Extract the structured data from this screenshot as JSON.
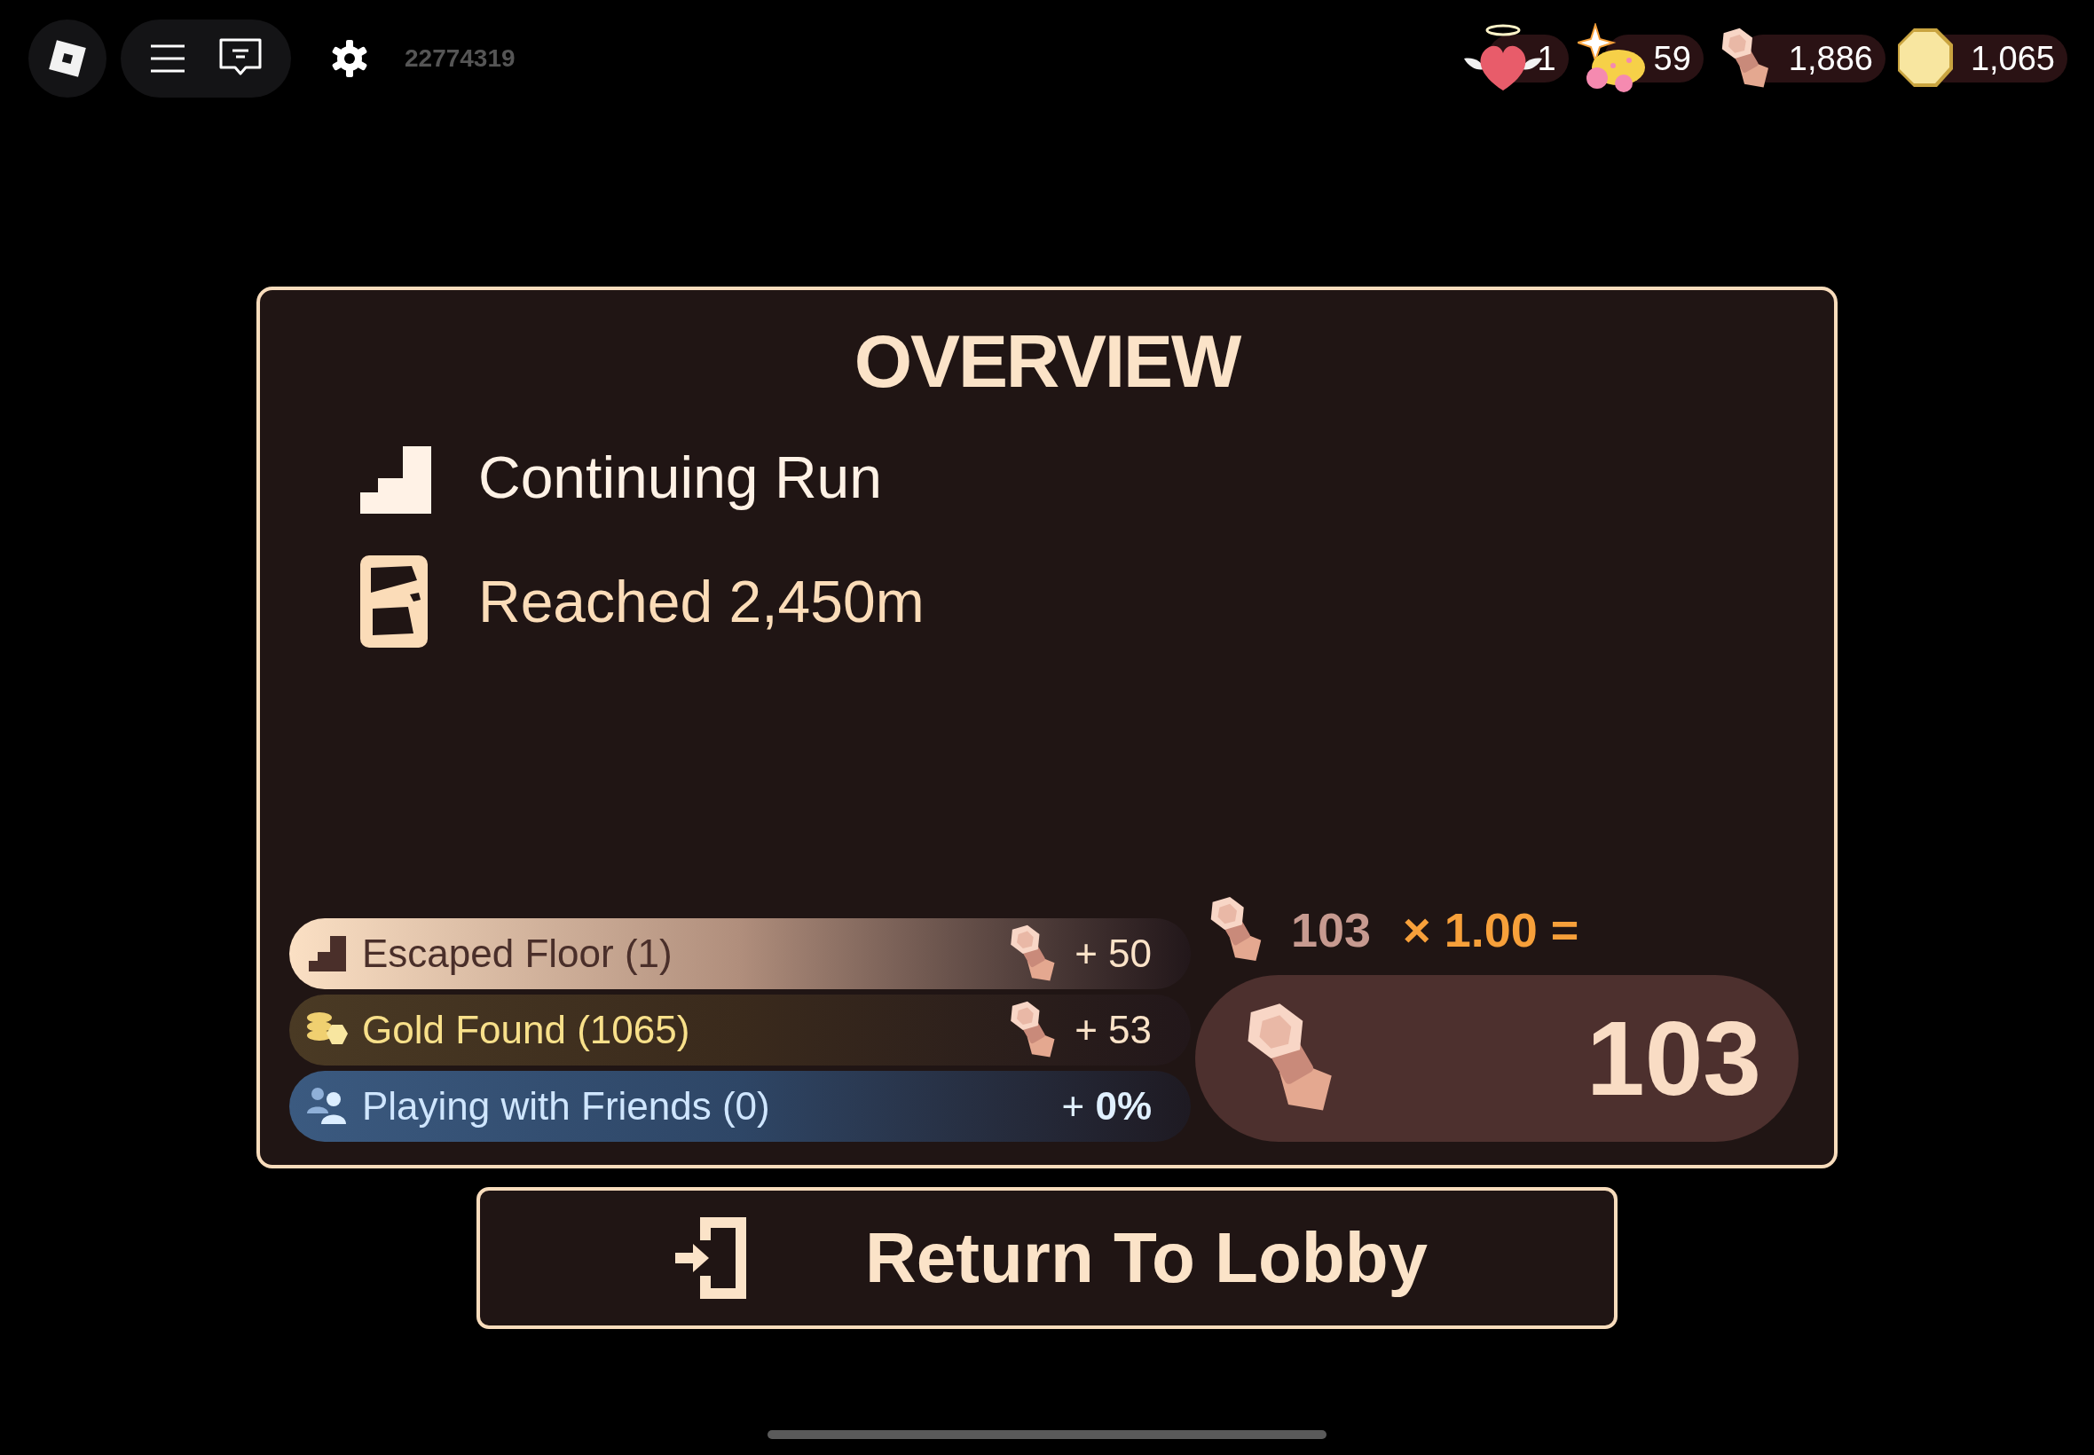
{
  "top_bar": {
    "user_id": "22774319"
  },
  "currencies": [
    {
      "kind": "heart",
      "value": "1"
    },
    {
      "kind": "star",
      "value": "59"
    },
    {
      "kind": "bolt",
      "value": "1,886"
    },
    {
      "kind": "coin",
      "value": "1,065"
    }
  ],
  "overview": {
    "title": "OVERVIEW",
    "lines": [
      {
        "kind": "stairs",
        "text": "Continuing Run"
      },
      {
        "kind": "map",
        "text": "Reached 2,450m"
      }
    ],
    "rewards": [
      {
        "kind": "floor",
        "label": "Escaped Floor (1)",
        "bonus": "+ 50"
      },
      {
        "kind": "gold",
        "label": "Gold Found (1065)",
        "bonus": "+ 53"
      },
      {
        "kind": "friends",
        "label": "Playing with Friends (0)",
        "bonus": "+ **0%**"
      }
    ],
    "calculation": {
      "base": "103",
      "multiplier": "× 1.00 =",
      "total": "103"
    }
  },
  "return_button": {
    "label": "Return To Lobby"
  }
}
